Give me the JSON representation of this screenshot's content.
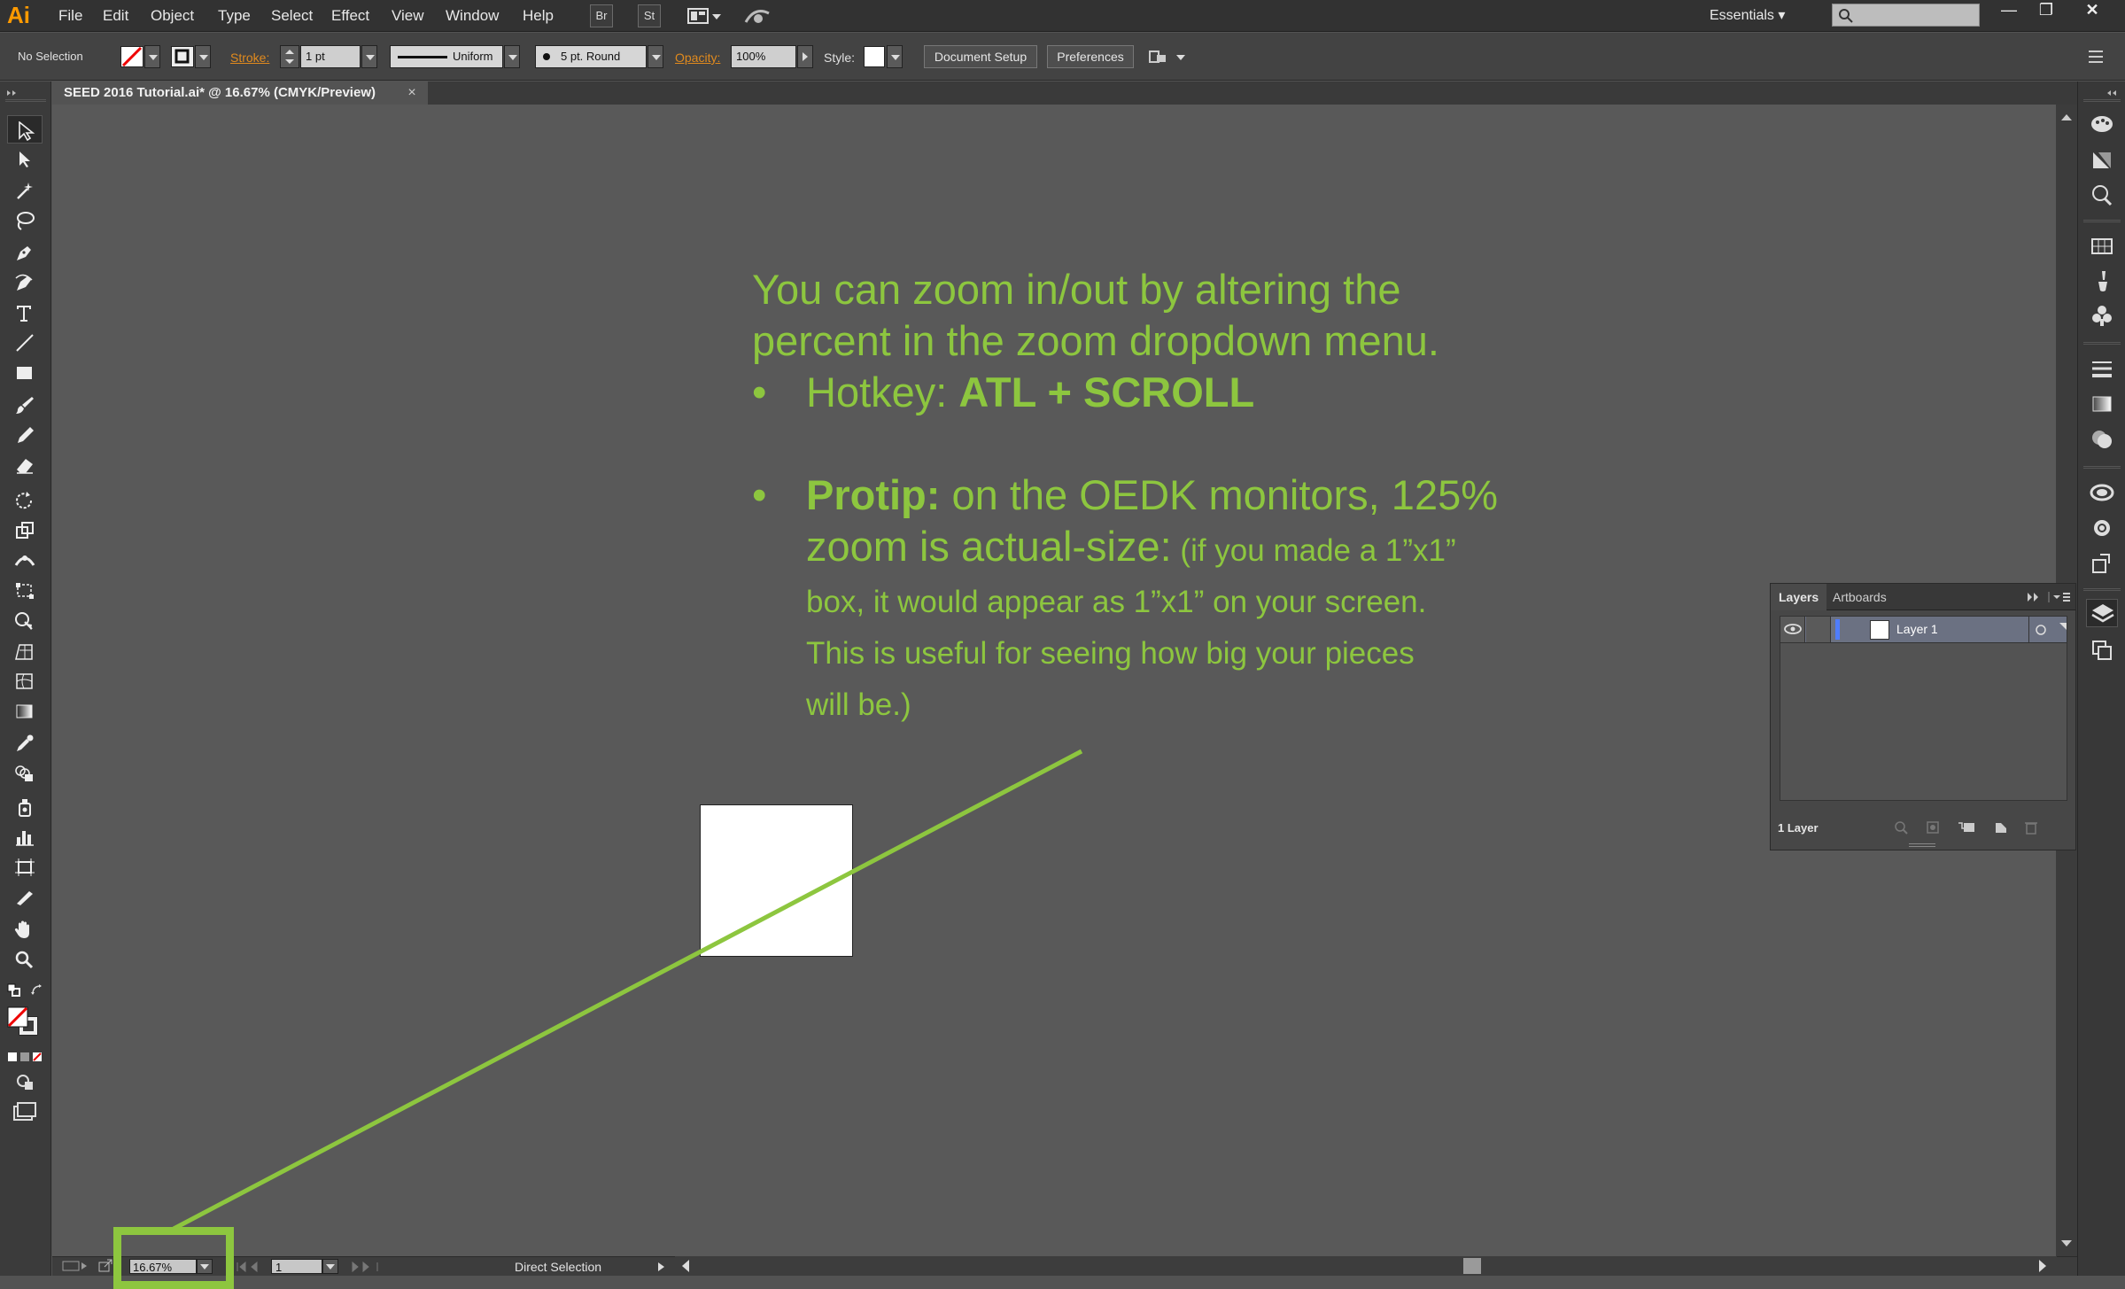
{
  "app": {
    "logo": "Ai",
    "brand_color": "#ff9a00"
  },
  "menu": {
    "items": [
      "File",
      "Edit",
      "Object",
      "Type",
      "Select",
      "Effect",
      "View",
      "Window",
      "Help"
    ],
    "bridge_label": "Br",
    "stock_label": "St",
    "workspace": "Essentials",
    "search_placeholder": ""
  },
  "control_bar": {
    "selection": "No Selection",
    "stroke_label": "Stroke:",
    "stroke_weight": "1 pt",
    "stroke_profile": "Uniform",
    "brush": "5 pt. Round",
    "opacity_label": "Opacity:",
    "opacity_value": "100%",
    "style_label": "Style:",
    "document_setup": "Document Setup",
    "preferences": "Preferences"
  },
  "document_tab": {
    "title": "SEED 2016 Tutorial.ai* @ 16.67% (CMYK/Preview)",
    "close": "×"
  },
  "canvas": {
    "line1": "You can zoom in/out by altering the",
    "line2": "percent in the zoom dropdown menu.",
    "hotkey_label": "Hotkey: ",
    "hotkey_value": "ATL + SCROLL",
    "bullet": "•",
    "protip_label": "Protip:",
    "protip_text": " on the OEDK monitors, 125%",
    "protip_line2": "zoom is actual-size:",
    "protip_small1": " (if you made a 1”x1”",
    "protip_small2": "box, it would appear as 1”x1” on your screen.",
    "protip_small3": "This is useful for seeing how big your pieces",
    "protip_small4": "will be.)",
    "accent_color": "#8dc63f"
  },
  "layers_panel": {
    "tab_layers": "Layers",
    "tab_artboards": "Artboards",
    "layer_name": "Layer 1",
    "footer_count": "1 Layer"
  },
  "status_bar": {
    "zoom": "16.67%",
    "artboard": "1",
    "tool": "Direct Selection"
  }
}
